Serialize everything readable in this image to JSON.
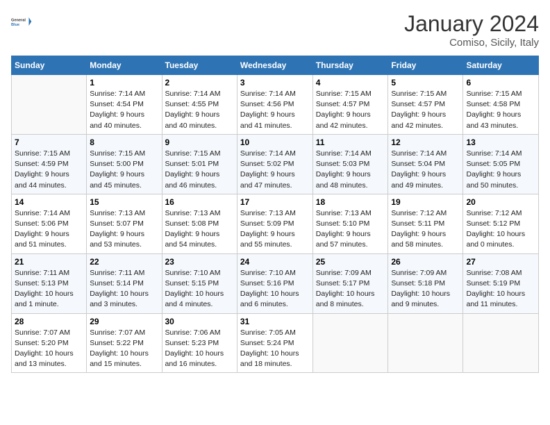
{
  "header": {
    "logo_text_general": "General",
    "logo_text_blue": "Blue",
    "month": "January 2024",
    "location": "Comiso, Sicily, Italy"
  },
  "weekdays": [
    "Sunday",
    "Monday",
    "Tuesday",
    "Wednesday",
    "Thursday",
    "Friday",
    "Saturday"
  ],
  "weeks": [
    [
      {
        "day": "",
        "info": ""
      },
      {
        "day": "1",
        "info": "Sunrise: 7:14 AM\nSunset: 4:54 PM\nDaylight: 9 hours\nand 40 minutes."
      },
      {
        "day": "2",
        "info": "Sunrise: 7:14 AM\nSunset: 4:55 PM\nDaylight: 9 hours\nand 40 minutes."
      },
      {
        "day": "3",
        "info": "Sunrise: 7:14 AM\nSunset: 4:56 PM\nDaylight: 9 hours\nand 41 minutes."
      },
      {
        "day": "4",
        "info": "Sunrise: 7:15 AM\nSunset: 4:57 PM\nDaylight: 9 hours\nand 42 minutes."
      },
      {
        "day": "5",
        "info": "Sunrise: 7:15 AM\nSunset: 4:57 PM\nDaylight: 9 hours\nand 42 minutes."
      },
      {
        "day": "6",
        "info": "Sunrise: 7:15 AM\nSunset: 4:58 PM\nDaylight: 9 hours\nand 43 minutes."
      }
    ],
    [
      {
        "day": "7",
        "info": "Sunrise: 7:15 AM\nSunset: 4:59 PM\nDaylight: 9 hours\nand 44 minutes."
      },
      {
        "day": "8",
        "info": "Sunrise: 7:15 AM\nSunset: 5:00 PM\nDaylight: 9 hours\nand 45 minutes."
      },
      {
        "day": "9",
        "info": "Sunrise: 7:15 AM\nSunset: 5:01 PM\nDaylight: 9 hours\nand 46 minutes."
      },
      {
        "day": "10",
        "info": "Sunrise: 7:14 AM\nSunset: 5:02 PM\nDaylight: 9 hours\nand 47 minutes."
      },
      {
        "day": "11",
        "info": "Sunrise: 7:14 AM\nSunset: 5:03 PM\nDaylight: 9 hours\nand 48 minutes."
      },
      {
        "day": "12",
        "info": "Sunrise: 7:14 AM\nSunset: 5:04 PM\nDaylight: 9 hours\nand 49 minutes."
      },
      {
        "day": "13",
        "info": "Sunrise: 7:14 AM\nSunset: 5:05 PM\nDaylight: 9 hours\nand 50 minutes."
      }
    ],
    [
      {
        "day": "14",
        "info": "Sunrise: 7:14 AM\nSunset: 5:06 PM\nDaylight: 9 hours\nand 51 minutes."
      },
      {
        "day": "15",
        "info": "Sunrise: 7:13 AM\nSunset: 5:07 PM\nDaylight: 9 hours\nand 53 minutes."
      },
      {
        "day": "16",
        "info": "Sunrise: 7:13 AM\nSunset: 5:08 PM\nDaylight: 9 hours\nand 54 minutes."
      },
      {
        "day": "17",
        "info": "Sunrise: 7:13 AM\nSunset: 5:09 PM\nDaylight: 9 hours\nand 55 minutes."
      },
      {
        "day": "18",
        "info": "Sunrise: 7:13 AM\nSunset: 5:10 PM\nDaylight: 9 hours\nand 57 minutes."
      },
      {
        "day": "19",
        "info": "Sunrise: 7:12 AM\nSunset: 5:11 PM\nDaylight: 9 hours\nand 58 minutes."
      },
      {
        "day": "20",
        "info": "Sunrise: 7:12 AM\nSunset: 5:12 PM\nDaylight: 10 hours\nand 0 minutes."
      }
    ],
    [
      {
        "day": "21",
        "info": "Sunrise: 7:11 AM\nSunset: 5:13 PM\nDaylight: 10 hours\nand 1 minute."
      },
      {
        "day": "22",
        "info": "Sunrise: 7:11 AM\nSunset: 5:14 PM\nDaylight: 10 hours\nand 3 minutes."
      },
      {
        "day": "23",
        "info": "Sunrise: 7:10 AM\nSunset: 5:15 PM\nDaylight: 10 hours\nand 4 minutes."
      },
      {
        "day": "24",
        "info": "Sunrise: 7:10 AM\nSunset: 5:16 PM\nDaylight: 10 hours\nand 6 minutes."
      },
      {
        "day": "25",
        "info": "Sunrise: 7:09 AM\nSunset: 5:17 PM\nDaylight: 10 hours\nand 8 minutes."
      },
      {
        "day": "26",
        "info": "Sunrise: 7:09 AM\nSunset: 5:18 PM\nDaylight: 10 hours\nand 9 minutes."
      },
      {
        "day": "27",
        "info": "Sunrise: 7:08 AM\nSunset: 5:19 PM\nDaylight: 10 hours\nand 11 minutes."
      }
    ],
    [
      {
        "day": "28",
        "info": "Sunrise: 7:07 AM\nSunset: 5:20 PM\nDaylight: 10 hours\nand 13 minutes."
      },
      {
        "day": "29",
        "info": "Sunrise: 7:07 AM\nSunset: 5:22 PM\nDaylight: 10 hours\nand 15 minutes."
      },
      {
        "day": "30",
        "info": "Sunrise: 7:06 AM\nSunset: 5:23 PM\nDaylight: 10 hours\nand 16 minutes."
      },
      {
        "day": "31",
        "info": "Sunrise: 7:05 AM\nSunset: 5:24 PM\nDaylight: 10 hours\nand 18 minutes."
      },
      {
        "day": "",
        "info": ""
      },
      {
        "day": "",
        "info": ""
      },
      {
        "day": "",
        "info": ""
      }
    ]
  ]
}
